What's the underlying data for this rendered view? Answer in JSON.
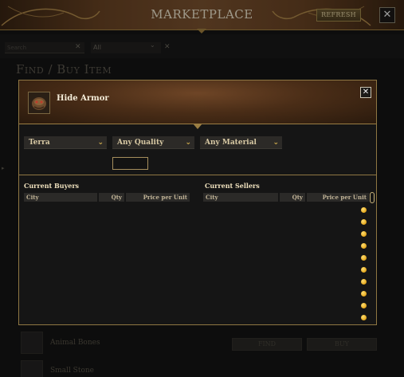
{
  "header": {
    "title": "MARKETPLACE",
    "refresh_label": "REFRESH",
    "close_glyph": "✕"
  },
  "filters": {
    "search_placeholder": "Search",
    "search_clear": "✕",
    "category_value": "All",
    "category_chevron": "⌄",
    "category_clear": "✕"
  },
  "section_title": "Find / Buy Item",
  "background_list": [
    {
      "label": "Animal Bones",
      "find_label": "FIND",
      "buy_label": "BUY"
    },
    {
      "label": "Small Stone"
    }
  ],
  "modal": {
    "item_name": "Hide Armor",
    "item_icon": "hide-armor-icon",
    "close_glyph": "✕",
    "dropdowns": [
      {
        "value": "Terra"
      },
      {
        "value": "Any Quality"
      },
      {
        "value": "Any Material"
      }
    ],
    "chevron": "⌄",
    "quantity_value": "",
    "buyers": {
      "title": "Current Buyers",
      "columns": [
        "City",
        "Qty",
        "Price per Unit"
      ]
    },
    "sellers": {
      "title": "Current Sellers",
      "columns": [
        "City",
        "Qty",
        "Price per Unit"
      ],
      "row_count": 10
    }
  },
  "colors": {
    "accent_gold": "#c8a75a",
    "coin": "#f0b32a",
    "header_brown": "#6a4424"
  }
}
